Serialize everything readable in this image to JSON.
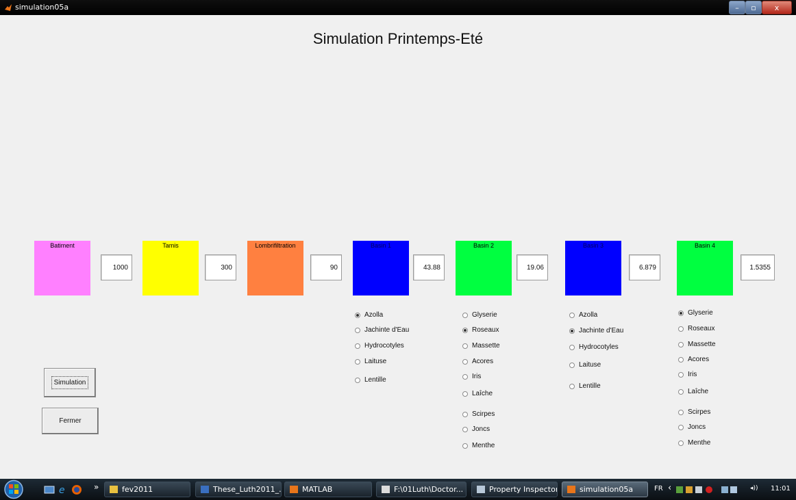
{
  "window": {
    "title": "simulation05a",
    "minimize": "–",
    "maximize": "▫",
    "close": "x"
  },
  "figure": {
    "title": "Simulation Printemps-Eté",
    "blocks": [
      {
        "label": "Batiment",
        "value": "1000",
        "color": "#ff80ff"
      },
      {
        "label": "Tamis",
        "value": "300",
        "color": "#ffff00"
      },
      {
        "label": "Lombrifiltration",
        "value": "90",
        "color": "#ff8040"
      },
      {
        "label": "Basin 1",
        "value": "43.88",
        "color": "#0000ff"
      },
      {
        "label": "Basin 2",
        "value": "19.06",
        "color": "#00ff40"
      },
      {
        "label": "Basin 3",
        "value": "6.879",
        "color": "#0000ff"
      },
      {
        "label": "Basin 4",
        "value": "1.5355",
        "color": "#00ff40"
      }
    ],
    "basin1_options": [
      {
        "label": "Azolla",
        "selected": true
      },
      {
        "label": "Jachinte d'Eau",
        "selected": false
      },
      {
        "label": "Hydrocotyles",
        "selected": false
      },
      {
        "label": "Laituse",
        "selected": false
      },
      {
        "label": "Lentille",
        "selected": false
      }
    ],
    "basin2_options": [
      {
        "label": "Glyserie",
        "selected": false
      },
      {
        "label": "Roseaux",
        "selected": true
      },
      {
        "label": "Massette",
        "selected": false
      },
      {
        "label": "Acores",
        "selected": false
      },
      {
        "label": "Iris",
        "selected": false
      },
      {
        "label": "Laîche",
        "selected": false
      },
      {
        "label": "Scirpes",
        "selected": false
      },
      {
        "label": "Joncs",
        "selected": false
      },
      {
        "label": "Menthe",
        "selected": false
      }
    ],
    "basin3_options": [
      {
        "label": "Azolla",
        "selected": false
      },
      {
        "label": "Jachinte d'Eau",
        "selected": true
      },
      {
        "label": "Hydrocotyles",
        "selected": false
      },
      {
        "label": "Laituse",
        "selected": false
      },
      {
        "label": "Lentille",
        "selected": false
      }
    ],
    "basin4_options": [
      {
        "label": "Glyserie",
        "selected": true
      },
      {
        "label": "Roseaux",
        "selected": false
      },
      {
        "label": "Massette",
        "selected": false
      },
      {
        "label": "Acores",
        "selected": false
      },
      {
        "label": "Iris",
        "selected": false
      },
      {
        "label": "Laîche",
        "selected": false
      },
      {
        "label": "Scirpes",
        "selected": false
      },
      {
        "label": "Joncs",
        "selected": false
      },
      {
        "label": "Menthe",
        "selected": false
      }
    ],
    "buttons": {
      "simulation": "Simulation",
      "fermer": "Fermer"
    }
  },
  "taskbar": {
    "chevron": "»",
    "items": [
      {
        "label": "fev2011",
        "icon": "folder-icon",
        "active": false
      },
      {
        "label": "These_Luth2011_...",
        "icon": "word-document-icon",
        "active": false
      },
      {
        "label": "MATLAB",
        "icon": "matlab-icon",
        "active": false
      },
      {
        "label": "F:\\01Luth\\Doctor...",
        "icon": "document-icon",
        "active": false
      },
      {
        "label": "Property Inspector",
        "icon": "inspector-icon",
        "active": false
      },
      {
        "label": "simulation05a",
        "icon": "matlab-icon",
        "active": true
      }
    ],
    "tray": {
      "language": "FR",
      "arrow": "‹",
      "clock": "11:01"
    }
  }
}
